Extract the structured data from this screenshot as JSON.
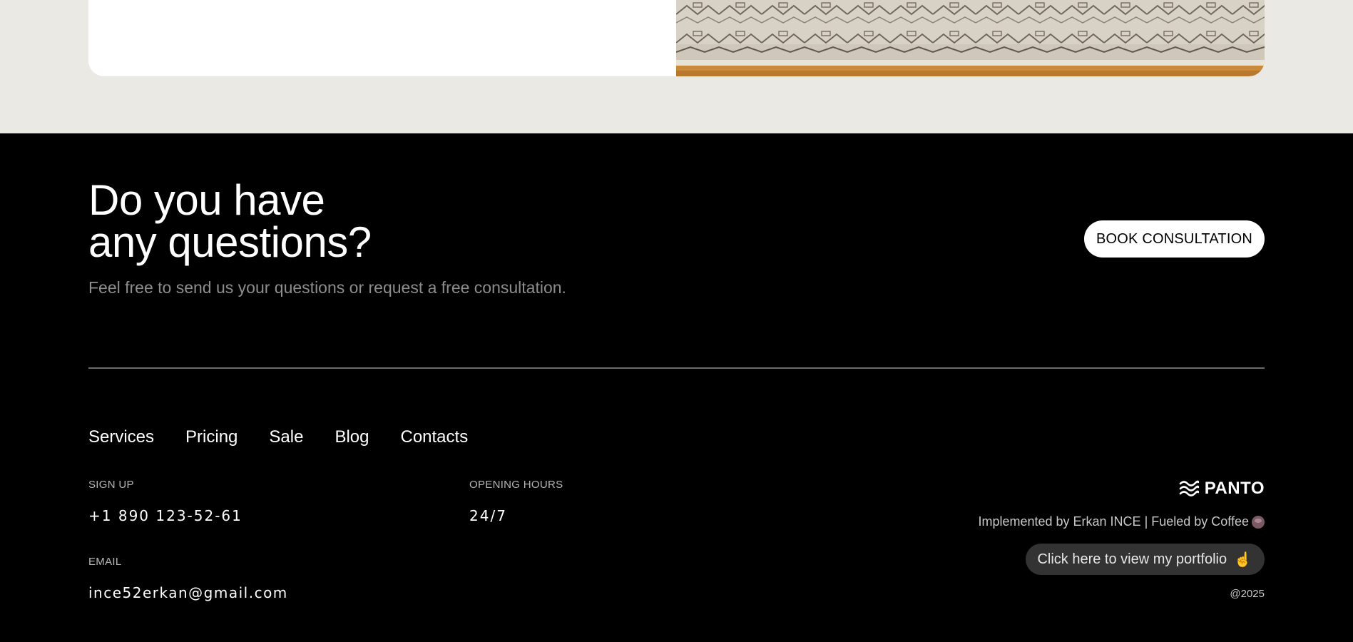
{
  "contact_section": {
    "heading_line1": "Do you have",
    "heading_line2": "any questions?",
    "subtitle": "Feel free to send us your questions or request a free consultation.",
    "cta_label": "BOOK CONSULTATION"
  },
  "footer_nav": {
    "items": [
      {
        "label": "Services"
      },
      {
        "label": "Pricing"
      },
      {
        "label": "Sale"
      },
      {
        "label": "Blog"
      },
      {
        "label": "Contacts"
      }
    ]
  },
  "sign_up": {
    "label": "SIGN UP",
    "phone": "+1 890 123-52-61"
  },
  "opening_hours": {
    "label": "OPENING HOURS",
    "value": "24/7"
  },
  "email": {
    "label": "EMAIL",
    "value": "ince52erkan@gmail.com"
  },
  "brand": {
    "name": "PANTO",
    "icon": "wave-logo-icon"
  },
  "credit": {
    "text": "Implemented by Erkan INCE | Fueled by Coffee",
    "icon": "coffee-icon"
  },
  "portfolio": {
    "label": "Click here to view my portfolio",
    "icon": "pointing-hand-icon"
  },
  "copyright": "@2025",
  "colors": {
    "page_top_bg": "#eae9e4",
    "footer_bg": "#000000",
    "button_bg": "#ffffff",
    "portfolio_bg": "#333333",
    "subtitle": "#8d8d8d"
  }
}
